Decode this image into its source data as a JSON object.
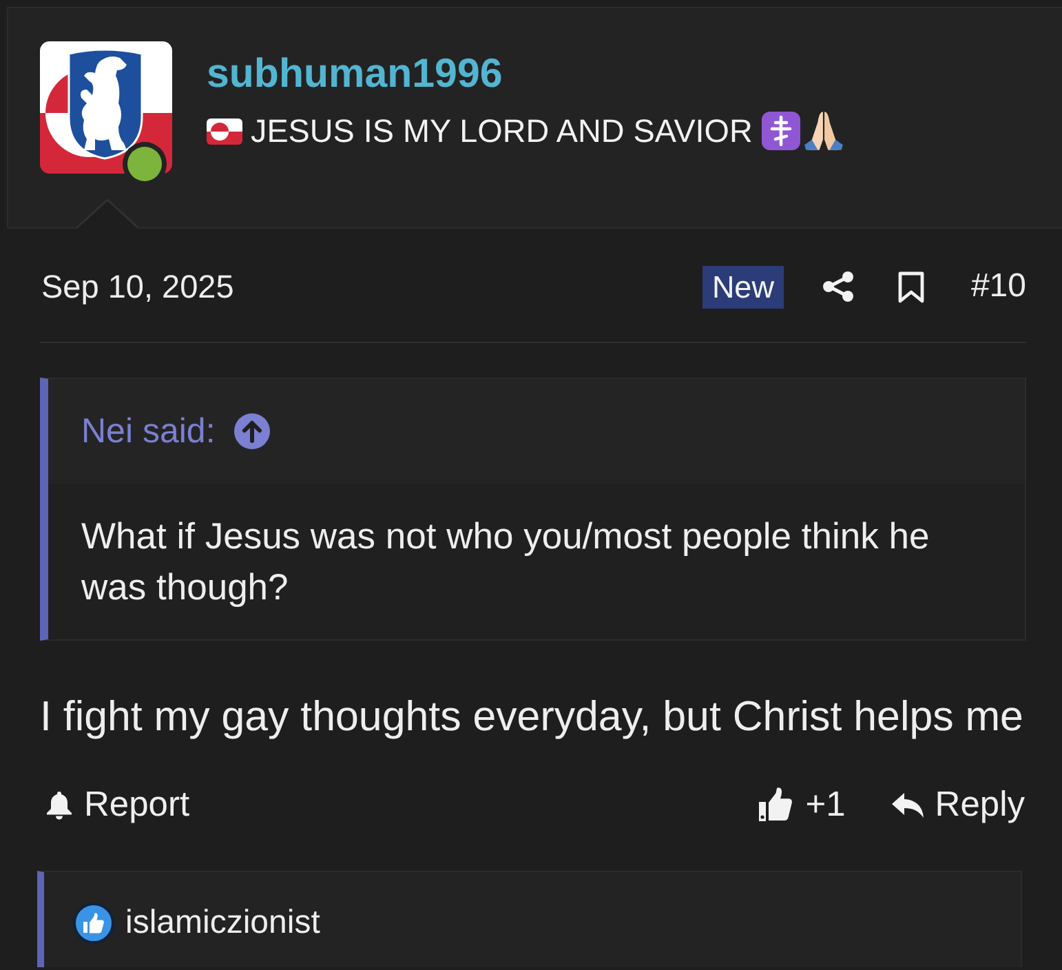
{
  "author": {
    "username": "subhuman1996",
    "online": true,
    "title": "JESUS IS MY LORD AND SAVIOR"
  },
  "post": {
    "date": "Sep 10, 2025",
    "badge": "New",
    "number": "#10"
  },
  "quote": {
    "attribution": "Nei said:",
    "text": "What if Jesus was not who you/most people think he was though?"
  },
  "message": "I fight my gay thoughts everyday, but Christ helps me",
  "actions": [
    {
      "kind": "report",
      "label": "Report"
    },
    {
      "kind": "like",
      "label": "+1"
    },
    {
      "kind": "reply",
      "label": "Reply"
    }
  ],
  "reactions": [
    {
      "kind": "like",
      "user": "islamiczionist"
    }
  ]
}
